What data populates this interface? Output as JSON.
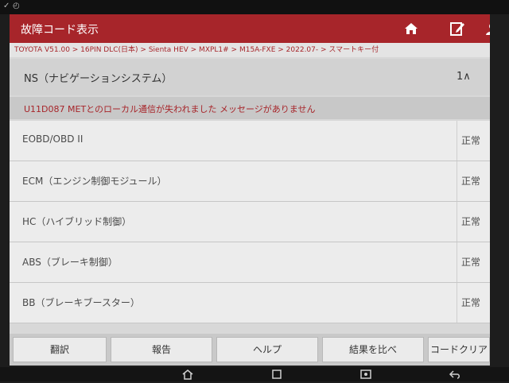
{
  "header": {
    "title": "故障コード表示"
  },
  "breadcrumb": "TOYOTA V51.00 > 16PIN DLC(日本) > Sienta HEV > MXPL1# > M15A-FXE > 2022.07- > スマートキー付",
  "system_row": {
    "name": "NS（ナビゲーションシステム）",
    "count": "1∧"
  },
  "message": "U11D087 METとのローカル通信が失われました メッセージがありません",
  "ecus": [
    {
      "name": "EOBD/OBD II",
      "status": "正常"
    },
    {
      "name": "ECM（エンジン制御モジュール）",
      "status": "正常"
    },
    {
      "name": "HC（ハイブリッド制御）",
      "status": "正常"
    },
    {
      "name": "ABS（ブレーキ制御）",
      "status": "正常"
    },
    {
      "name": "BB（ブレーキブースター）",
      "status": "正常"
    }
  ],
  "bottom_buttons": [
    "翻訳",
    "報告",
    "ヘルプ",
    "結果を比べ",
    "コードクリア"
  ],
  "icons": [
    "home-icon",
    "edit-icon",
    "user-icon",
    "back-icon",
    "recents-icon",
    "screenshot-icon"
  ],
  "colors": {
    "header": "#a7252a",
    "accent_text": "#a7252a"
  }
}
